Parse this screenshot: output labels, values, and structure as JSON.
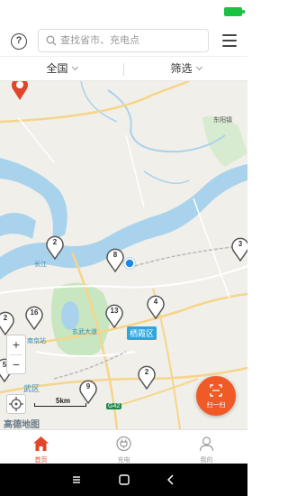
{
  "status_bar": {
    "battery_color": "#19c23f"
  },
  "search": {
    "placeholder": "查找省市、充电点",
    "value": ""
  },
  "filters": {
    "region_label": "全国",
    "filter_label": "筛选"
  },
  "map": {
    "places": {
      "dongyang": "东阳镇",
      "changjiang": "长江",
      "nanjing_station": "南京站",
      "road_label": "玄武大道",
      "qixia": "栖霞区",
      "dist_left": "武区",
      "highway": "G42"
    },
    "pins": [
      {
        "id": "pin-1",
        "count": "2"
      },
      {
        "id": "pin-2",
        "count": "8"
      },
      {
        "id": "pin-3",
        "count": "3"
      },
      {
        "id": "pin-4",
        "count": "13"
      },
      {
        "id": "pin-5",
        "count": "4"
      },
      {
        "id": "pin-6",
        "count": "16"
      },
      {
        "id": "pin-7",
        "count": "2"
      },
      {
        "id": "pin-8",
        "count": "5"
      },
      {
        "id": "pin-9",
        "count": "2"
      },
      {
        "id": "pin-10",
        "count": "9"
      }
    ],
    "district_badge": "栖霞区",
    "scale_label": "5km",
    "attribution": "高德地图",
    "zoom_in": "+",
    "zoom_out": "−"
  },
  "scan": {
    "label": "扫一扫",
    "color": "#f05a26"
  },
  "tabs": [
    {
      "label": "首页",
      "icon": "home-icon",
      "active": true
    },
    {
      "label": "充电",
      "icon": "charge-plug-icon",
      "active": false
    },
    {
      "label": "我的",
      "icon": "user-icon",
      "active": false
    }
  ],
  "colors": {
    "accent": "#e2462a",
    "water": "#a9d3ec",
    "location_dot": "#1e88e5"
  }
}
